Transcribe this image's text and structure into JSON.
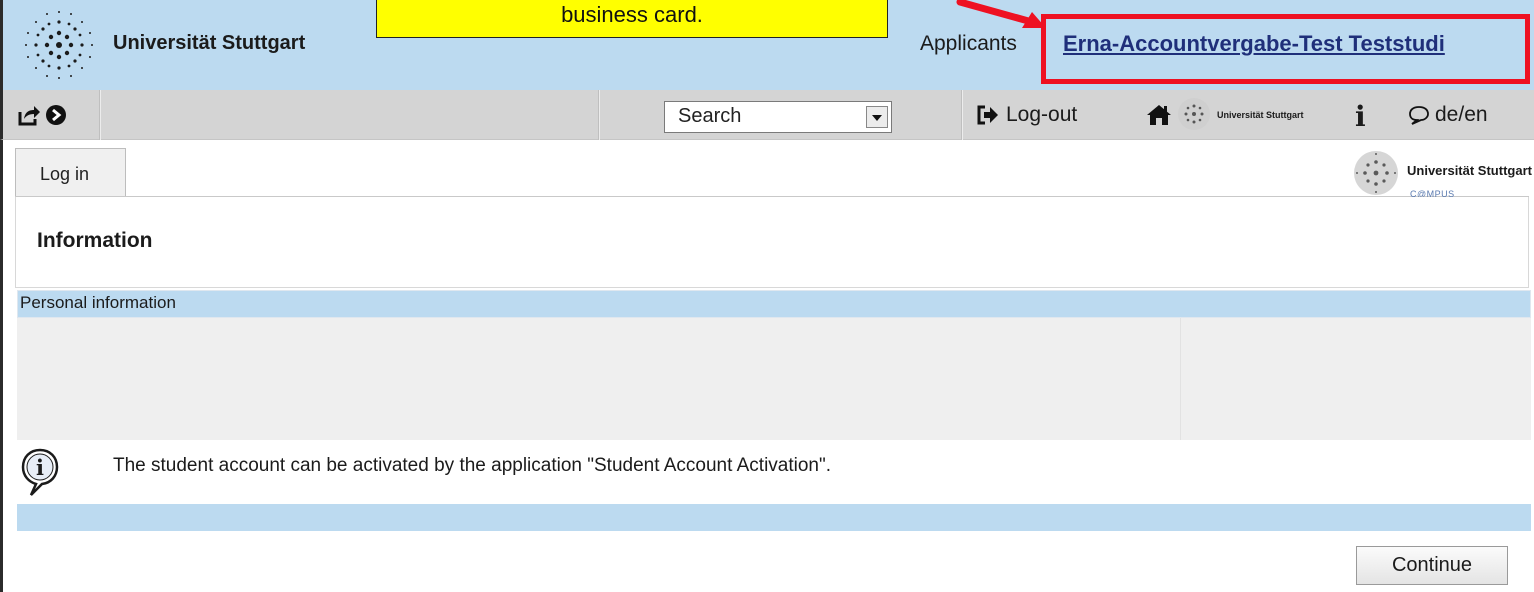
{
  "callout": {
    "text": "business card."
  },
  "header": {
    "university_name": "Universität Stuttgart",
    "role_label": "Applicants",
    "user_name": "Erna-Accountvergabe-Test Teststudi",
    "highlight_color": "#ee1122",
    "background_color": "#bcdaf0"
  },
  "toolbar": {
    "icons": [
      "share-icon",
      "forward-circle-icon"
    ],
    "search": {
      "selected": "Search"
    },
    "logout_label": "Log-out",
    "home_icon": "home-icon",
    "small_logo_text": "Universität Stuttgart",
    "info_icon": "info-icon",
    "language_label": "de/en"
  },
  "tabs": [
    {
      "label": "Log in"
    }
  ],
  "campus_logo": {
    "name": "Universität Stuttgart",
    "sub": "C@MPUS"
  },
  "page": {
    "title": "Information",
    "section_label": "Personal information",
    "message": "The student account can be activated by the application \"Student Account Activation\".",
    "continue_label": "Continue"
  }
}
